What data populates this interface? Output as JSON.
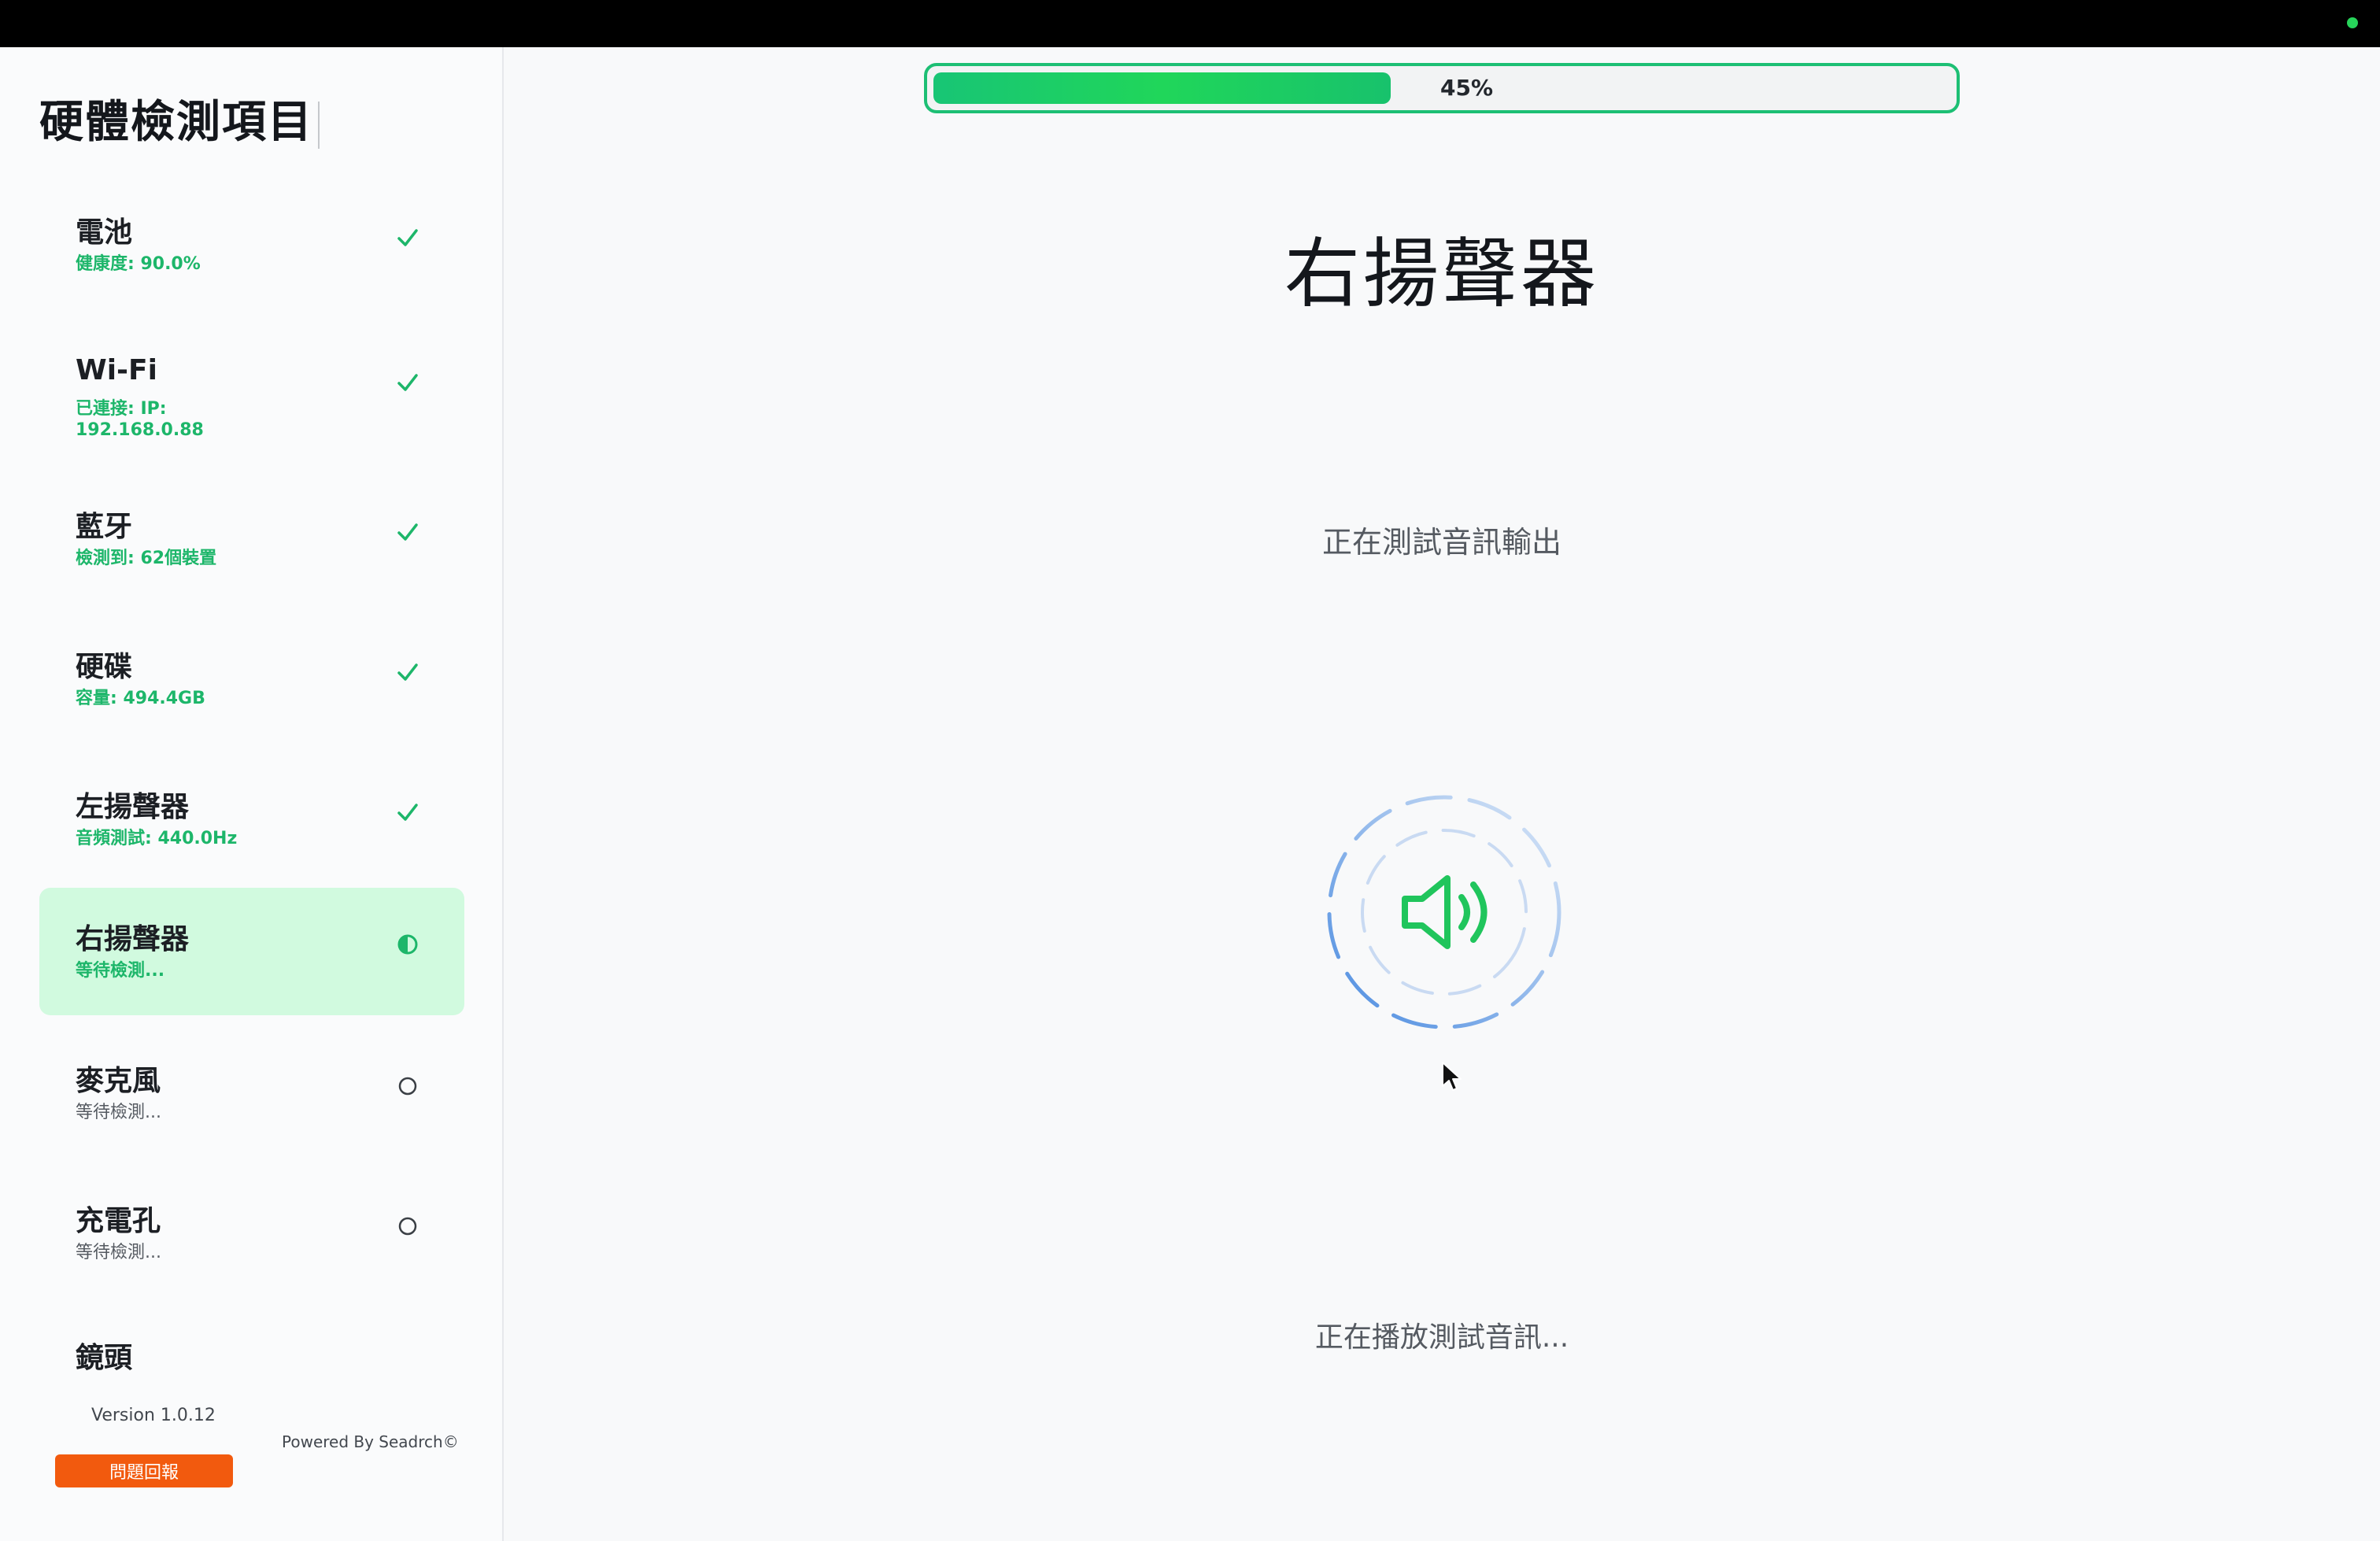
{
  "sidebar": {
    "title": "硬體檢測項目",
    "items": [
      {
        "name": "電池",
        "sub": "健康度: 90.0%",
        "state": "done"
      },
      {
        "name": "Wi-Fi",
        "sub": "已連接: IP: 192.168.0.88",
        "state": "done"
      },
      {
        "name": "藍牙",
        "sub": "檢測到: 62個裝置",
        "state": "done"
      },
      {
        "name": "硬碟",
        "sub": "容量: 494.4GB",
        "state": "done"
      },
      {
        "name": "左揚聲器",
        "sub": "音頻測試: 440.0Hz",
        "state": "done"
      },
      {
        "name": "右揚聲器",
        "sub": "等待檢測...",
        "state": "active"
      },
      {
        "name": "麥克風",
        "sub": "等待檢測...",
        "state": "pending"
      },
      {
        "name": "充電孔",
        "sub": "等待檢測...",
        "state": "pending"
      },
      {
        "name": "鏡頭",
        "sub": "",
        "state": "pending"
      }
    ],
    "version": "Version 1.0.12",
    "powered_by": "Powered By Seadrch©",
    "report_button": "問題回報"
  },
  "main": {
    "progress": {
      "value": 45,
      "label": "45%"
    },
    "title": "右揚聲器",
    "subtitle": "正在測試音訊輸出",
    "status": "正在播放測試音訊..."
  },
  "icons": {
    "done": "check-icon",
    "active": "half-circle-icon",
    "pending": "empty-circle-icon",
    "speaker": "speaker-volume-icon"
  },
  "colors": {
    "accent_green": "#1db66a",
    "active_bg": "#d1fadf",
    "report_orange": "#f25a0e",
    "spinner_blue": "#4a8be0"
  }
}
